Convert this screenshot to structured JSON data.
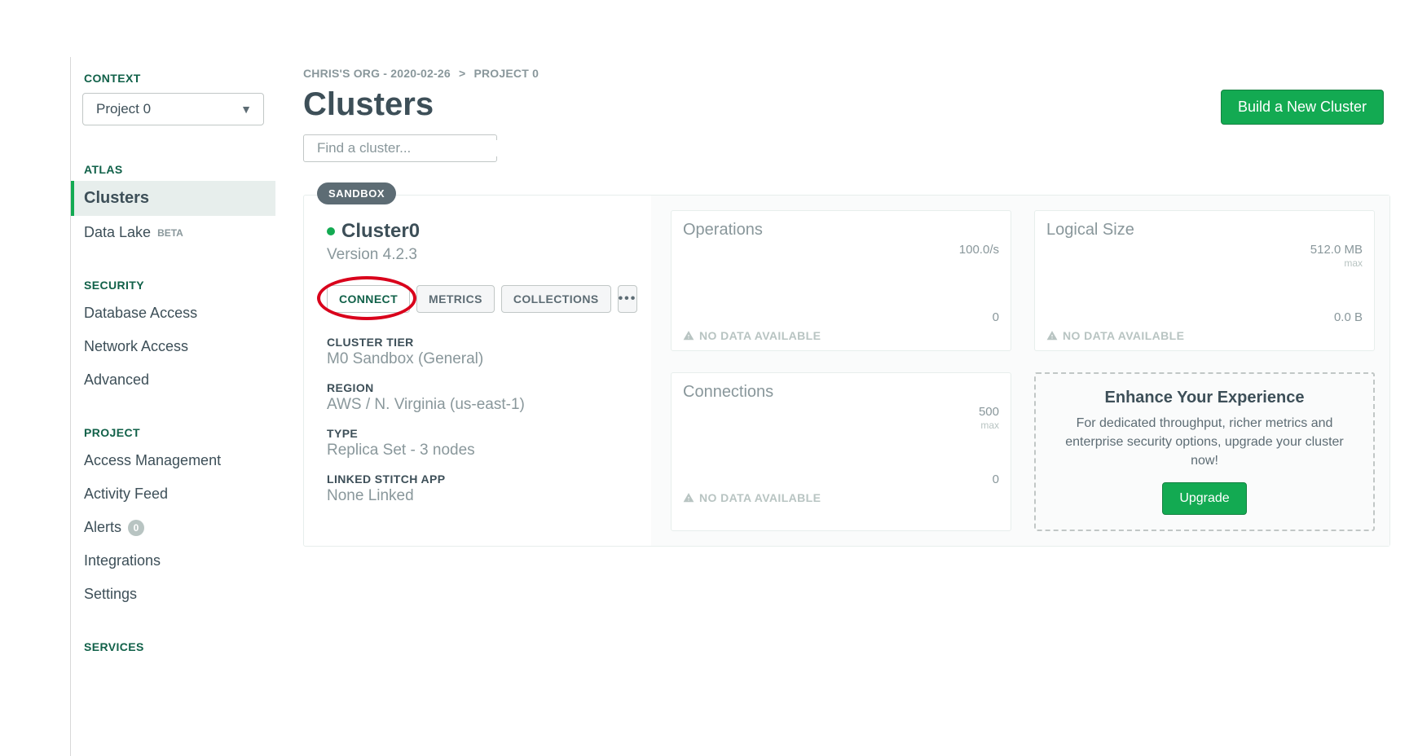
{
  "sidebar": {
    "context_label": "CONTEXT",
    "project_selected": "Project 0",
    "sections": {
      "atlas": {
        "label": "ATLAS",
        "items": [
          {
            "label": "Clusters",
            "active": true
          },
          {
            "label": "Data Lake",
            "badge": "BETA"
          }
        ]
      },
      "security": {
        "label": "SECURITY",
        "items": [
          {
            "label": "Database Access"
          },
          {
            "label": "Network Access"
          },
          {
            "label": "Advanced"
          }
        ]
      },
      "project": {
        "label": "PROJECT",
        "items": [
          {
            "label": "Access Management"
          },
          {
            "label": "Activity Feed"
          },
          {
            "label": "Alerts",
            "count": "0"
          },
          {
            "label": "Integrations"
          },
          {
            "label": "Settings"
          }
        ]
      },
      "services": {
        "label": "SERVICES"
      }
    }
  },
  "breadcrumb": {
    "org": "CHRIS'S ORG - 2020-02-26",
    "sep": ">",
    "project": "PROJECT 0"
  },
  "page_title": "Clusters",
  "build_button": "Build a New Cluster",
  "search_placeholder": "Find a cluster...",
  "cluster": {
    "badge": "SANDBOX",
    "name": "Cluster0",
    "version": "Version 4.2.3",
    "buttons": {
      "connect": "CONNECT",
      "metrics": "METRICS",
      "collections": "COLLECTIONS",
      "more": "•••"
    },
    "meta": {
      "tier_label": "CLUSTER TIER",
      "tier_value": "M0 Sandbox (General)",
      "region_label": "REGION",
      "region_value": "AWS / N. Virginia (us-east-1)",
      "type_label": "TYPE",
      "type_value": "Replica Set - 3 nodes",
      "stitch_label": "LINKED STITCH APP",
      "stitch_value": "None Linked"
    },
    "charts": {
      "operations": {
        "title": "Operations",
        "top": "100.0/s",
        "bottom": "0",
        "no_data": "NO DATA AVAILABLE"
      },
      "logical_size": {
        "title": "Logical Size",
        "top": "512.0 MB",
        "top_sub": "max",
        "bottom": "0.0 B",
        "no_data": "NO DATA AVAILABLE"
      },
      "connections": {
        "title": "Connections",
        "top": "500",
        "top_sub": "max",
        "bottom": "0",
        "no_data": "NO DATA AVAILABLE"
      }
    },
    "upgrade": {
      "title": "Enhance Your Experience",
      "text": "For dedicated throughput, richer metrics and enterprise security options, upgrade your cluster now!",
      "button": "Upgrade"
    }
  },
  "chart_data": [
    {
      "type": "line",
      "title": "Operations",
      "ylabel": "",
      "ylim": [
        0,
        100
      ],
      "unit": "/s",
      "series": [],
      "no_data": true
    },
    {
      "type": "line",
      "title": "Logical Size",
      "ylabel": "",
      "ylim": [
        0,
        512
      ],
      "unit": "MB",
      "series": [],
      "no_data": true
    },
    {
      "type": "line",
      "title": "Connections",
      "ylabel": "",
      "ylim": [
        0,
        500
      ],
      "unit": "",
      "series": [],
      "no_data": true
    }
  ]
}
